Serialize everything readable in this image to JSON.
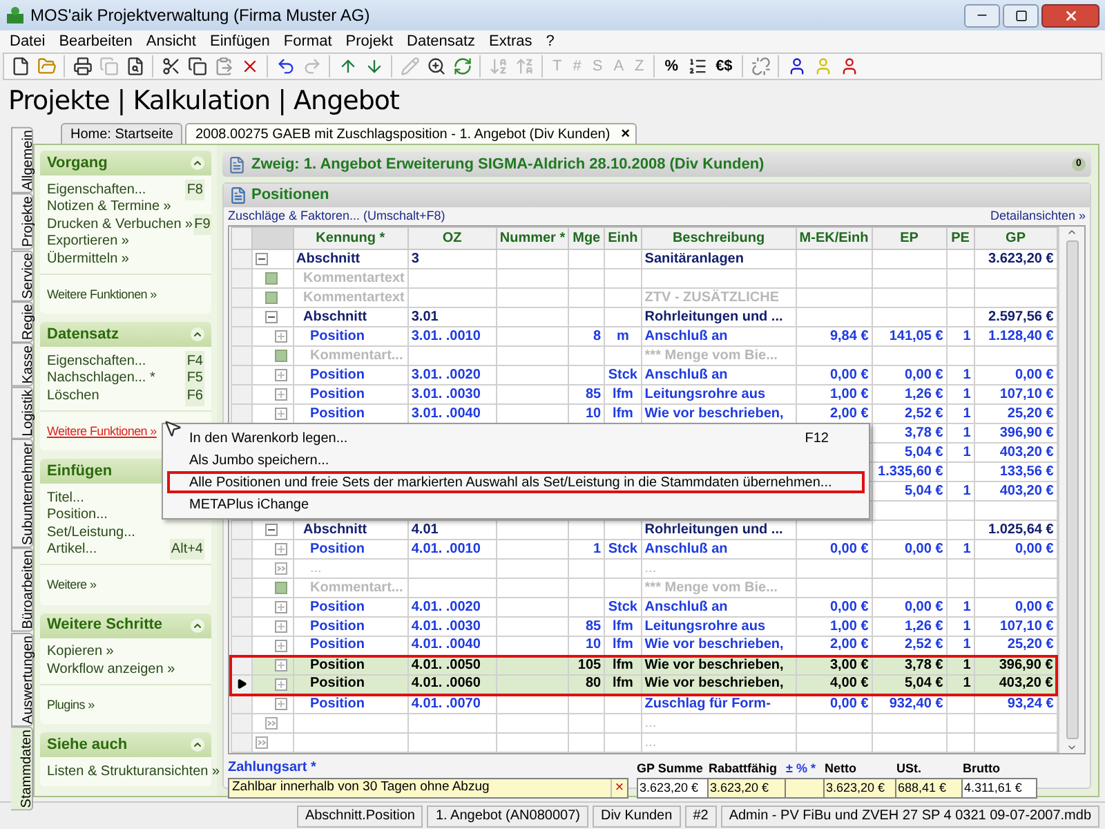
{
  "window": {
    "title": "MOS'aik Projektverwaltung (Firma Muster AG)"
  },
  "menu_bar": [
    "Datei",
    "Bearbeiten",
    "Ansicht",
    "Einfügen",
    "Format",
    "Projekt",
    "Datensatz",
    "Extras",
    "?"
  ],
  "toolbar": {
    "glyph_buttons": [
      {
        "label": "T",
        "disabled": true
      },
      {
        "label": "#",
        "disabled": true
      },
      {
        "label": "S",
        "disabled": true
      },
      {
        "label": "A",
        "disabled": true
      },
      {
        "label": "Z",
        "disabled": true
      },
      {
        "label": "%",
        "disabled": false
      },
      {
        "label": "€$",
        "disabled": false
      }
    ]
  },
  "breadcrumb": "Projekte | Kalkulation | Angebot",
  "side_tabs": [
    {
      "label": "Allgemein",
      "selected": false
    },
    {
      "label": "Projekte",
      "selected": false
    },
    {
      "label": "Service",
      "selected": false
    },
    {
      "label": "Regie",
      "selected": false
    },
    {
      "label": "Kasse",
      "selected": false
    },
    {
      "label": "Logistik",
      "selected": false
    },
    {
      "label": "Subunternehmer",
      "selected": false
    },
    {
      "label": "Büroarbeiten",
      "selected": false
    },
    {
      "label": "Auswertungen",
      "selected": false
    },
    {
      "label": "Stammdaten",
      "selected": true
    }
  ],
  "doc_tabs": [
    {
      "label": "Home: Startseite",
      "selected": false,
      "closable": false
    },
    {
      "label": "2008.00275 GAEB mit Zuschlagsposition - 1. Angebot (Div Kunden)",
      "selected": true,
      "closable": true
    }
  ],
  "close_glyph": "×",
  "sidebar": {
    "sections": [
      {
        "title": "Vorgang",
        "toggle": true,
        "items": [
          {
            "label": "Eigenschaften...",
            "shortcut": "F8"
          },
          {
            "label": "Notizen & Termine »"
          },
          {
            "label": "Drucken & Verbuchen »",
            "shortcut": "F9"
          },
          {
            "label": "Exportieren »"
          },
          {
            "label": "Übermitteln »"
          }
        ],
        "more": [
          {
            "label": "Weitere Funktionen »",
            "hovered": false
          }
        ]
      },
      {
        "title": "Datensatz",
        "toggle": true,
        "items": [
          {
            "label": "Eigenschaften...",
            "shortcut": "F4"
          },
          {
            "label": "Nachschlagen... *",
            "shortcut": "F5"
          },
          {
            "label": "Löschen",
            "shortcut": "F6"
          }
        ],
        "more": [
          {
            "label": "Weitere Funktionen »",
            "hovered": true
          }
        ]
      },
      {
        "title": "Einfügen",
        "toggle": false,
        "items": [
          {
            "label": "Titel..."
          },
          {
            "label": "Position..."
          },
          {
            "label": "Set/Leistung..."
          },
          {
            "label": "Artikel...",
            "shortcut": "Alt+4"
          }
        ],
        "more": [
          {
            "label": "Weitere »",
            "hovered": false
          }
        ]
      },
      {
        "title": "Weitere Schritte",
        "toggle": true,
        "items": [
          {
            "label": "Kopieren »"
          },
          {
            "label": "Workflow anzeigen »"
          }
        ],
        "more": [
          {
            "label": "Plugins »",
            "hovered": false
          }
        ]
      },
      {
        "title": "Siehe auch",
        "toggle": true,
        "items": [
          {
            "label": "Listen & Strukturansichten »"
          }
        ]
      }
    ]
  },
  "branch": {
    "title": "Zweig: 1. Angebot Erweiterung SIGMA-Aldrich 28.10.2008 (Div Kunden)",
    "badge": "0"
  },
  "positions": {
    "title": "Positionen",
    "left_link": "Zuschläge & Faktoren... (Umschalt+F8)",
    "right_link": "Detailansichten »",
    "table": {
      "columns": [
        "Kennung *",
        "OZ",
        "Nummer *",
        "Mge",
        "Einh",
        "Beschreibung",
        "M-EK/Einh",
        "EP",
        "PE",
        "GP"
      ],
      "rows": [
        {
          "kind": "abschnitt",
          "kennung": "Abschnitt",
          "oz": "3",
          "beschreibung": "Sanitäranlagen",
          "gp": "3.623,20 €",
          "selected": false,
          "current": false,
          "children": [
            {
              "kind": "kommentar",
              "kennung": "Kommentartext",
              "selected": false,
              "current": false
            },
            {
              "kind": "kommentar",
              "kennung": "Kommentartext",
              "beschreibung": "ZTV - ZUSÄTZLICHE",
              "selected": false,
              "current": false
            },
            {
              "kind": "abschnitt",
              "kennung": "Abschnitt",
              "oz": "3.01",
              "beschreibung": "Rohrleitungen und ...",
              "gp": "2.597,56 €",
              "selected": false,
              "current": false,
              "children": [
                {
                  "kind": "position",
                  "kennung": "Position",
                  "oz": "3.01.  .0010",
                  "mge": "8",
                  "einh": "m",
                  "beschreibung": "Anschluß an",
                  "m_ek": "9,84 €",
                  "ep": "141,05 €",
                  "pe": "1",
                  "gp": "1.128,40 €",
                  "selected": false,
                  "current": false
                },
                {
                  "kind": "kommentar",
                  "kennung": "Kommentart...",
                  "beschreibung": "*** Menge vom Bie...",
                  "selected": false,
                  "current": false
                },
                {
                  "kind": "position",
                  "kennung": "Position",
                  "oz": "3.01.  .0020",
                  "einh": "Stck",
                  "beschreibung": "Anschluß an",
                  "m_ek": "0,00 €",
                  "ep": "0,00 €",
                  "pe": "1",
                  "gp": "0,00 €",
                  "selected": false,
                  "current": false
                },
                {
                  "kind": "position",
                  "kennung": "Position",
                  "oz": "3.01.  .0030",
                  "mge": "85",
                  "einh": "lfm",
                  "beschreibung": "Leitungsrohre aus",
                  "m_ek": "1,00 €",
                  "ep": "1,26 €",
                  "pe": "1",
                  "gp": "107,10 €",
                  "selected": false,
                  "current": false
                },
                {
                  "kind": "position",
                  "kennung": "Position",
                  "oz": "3.01.  .0040",
                  "mge": "10",
                  "einh": "lfm",
                  "beschreibung": "Wie vor beschrieben,",
                  "m_ek": "2,00 €",
                  "ep": "2,52 €",
                  "pe": "1",
                  "gp": "25,20 €",
                  "selected": false,
                  "current": false
                },
                {
                  "kind": "covered",
                  "ep": "3,78 €",
                  "pe": "1",
                  "gp": "396,90 €",
                  "selected": false,
                  "current": false
                },
                {
                  "kind": "covered",
                  "ep": "5,04 €",
                  "pe": "1",
                  "gp": "403,20 €",
                  "selected": false,
                  "current": false
                },
                {
                  "kind": "covered",
                  "ep": "1.335,60 €",
                  "gp": "133,56 €",
                  "selected": false,
                  "current": false
                },
                {
                  "kind": "covered",
                  "ep": "5,04 €",
                  "pe": "1",
                  "gp": "403,20 €",
                  "selected": false,
                  "current": false
                },
                {
                  "kind": "covered",
                  "selected": false,
                  "current": false
                }
              ]
            },
            {
              "kind": "abschnitt",
              "kennung": "Abschnitt",
              "oz": "4.01",
              "beschreibung": "Rohrleitungen und ...",
              "gp": "1.025,64 €",
              "selected": false,
              "current": false,
              "children": [
                {
                  "kind": "position",
                  "kennung": "Position",
                  "oz": "4.01.  .0010",
                  "mge": "1",
                  "einh": "Stck",
                  "beschreibung": "Anschluß an",
                  "m_ek": "0,00 €",
                  "ep": "0,00 €",
                  "pe": "1",
                  "gp": "0,00 €",
                  "selected": false,
                  "current": false
                },
                {
                  "kind": "more",
                  "kennung": "...",
                  "beschreibung": "...",
                  "selected": false,
                  "current": false
                },
                {
                  "kind": "kommentar",
                  "kennung": "Kommentart...",
                  "beschreibung": "*** Menge vom Bie...",
                  "selected": false,
                  "current": false
                },
                {
                  "kind": "position",
                  "kennung": "Position",
                  "oz": "4.01.  .0020",
                  "einh": "Stck",
                  "beschreibung": "Anschluß an",
                  "m_ek": "0,00 €",
                  "ep": "0,00 €",
                  "pe": "1",
                  "gp": "0,00 €",
                  "selected": false,
                  "current": false
                },
                {
                  "kind": "position",
                  "kennung": "Position",
                  "oz": "4.01.  .0030",
                  "mge": "85",
                  "einh": "lfm",
                  "beschreibung": "Leitungsrohre aus",
                  "m_ek": "1,00 €",
                  "ep": "1,26 €",
                  "pe": "1",
                  "gp": "107,10 €",
                  "selected": false,
                  "current": false
                },
                {
                  "kind": "position",
                  "kennung": "Position",
                  "oz": "4.01.  .0040",
                  "mge": "10",
                  "einh": "lfm",
                  "beschreibung": "Wie vor beschrieben,",
                  "m_ek": "2,00 €",
                  "ep": "2,52 €",
                  "pe": "1",
                  "gp": "25,20 €",
                  "selected": false,
                  "current": false
                },
                {
                  "kind": "position",
                  "kennung": "Position",
                  "oz": "4.01.  .0050",
                  "mge": "105",
                  "einh": "lfm",
                  "beschreibung": "Wie vor beschrieben,",
                  "m_ek": "3,00 €",
                  "ep": "3,78 €",
                  "pe": "1",
                  "gp": "396,90 €",
                  "selected": true,
                  "current": false
                },
                {
                  "kind": "position",
                  "kennung": "Position",
                  "oz": "4.01.  .0060",
                  "mge": "80",
                  "einh": "lfm",
                  "beschreibung": "Wie vor beschrieben,",
                  "m_ek": "4,00 €",
                  "ep": "5,04 €",
                  "pe": "1",
                  "gp": "403,20 €",
                  "selected": true,
                  "current": true
                },
                {
                  "kind": "position",
                  "kennung": "Position",
                  "oz": "4.01.  .0070",
                  "beschreibung": "Zuschlag für Form-",
                  "m_ek": "0,00 €",
                  "ep": "932,40 €",
                  "gp": "93,24 €",
                  "selected": false,
                  "current": false
                }
              ]
            },
            {
              "kind": "more",
              "beschreibung": "...",
              "selected": false,
              "current": false
            }
          ]
        },
        {
          "kind": "more",
          "beschreibung": "...",
          "selected": false,
          "current": false
        }
      ]
    }
  },
  "payment": {
    "label": "Zahlungsart *",
    "value": "Zahlbar innerhalb von 30 Tagen ohne Abzug",
    "clear_glyph": "×"
  },
  "totals": [
    {
      "label": "GP Summe",
      "value": "3.623,20 €",
      "editable": false
    },
    {
      "label": "Rabattfähig",
      "value": "3.623,20 €",
      "editable": true
    },
    {
      "label": "± % *",
      "editable": true
    },
    {
      "label": "Netto",
      "value": "3.623,20 €",
      "editable": true
    },
    {
      "label": "USt.",
      "value": "688,41 €",
      "editable": true
    },
    {
      "label": "Brutto",
      "value": "4.311,61 €",
      "editable": false
    }
  ],
  "context_menu": [
    {
      "label": "In den Warenkorb legen...",
      "shortcut": "F12",
      "highlighted": false
    },
    {
      "label": "Als Jumbo speichern...",
      "highlighted": false
    },
    {
      "label": "Alle Positionen und freie Sets der markierten Auswahl als Set/Leistung in die Stammdaten übernehmen...",
      "highlighted": true
    },
    {
      "label": "METAPlus iChange",
      "highlighted": false
    }
  ],
  "status_bar": [
    "Abschnitt.Position",
    "1. Angebot (AN080007)",
    "Div Kunden",
    "#2",
    "Admin - PV FiBu und ZVEH 27 SP 4 0321 09-07-2007.mdb"
  ]
}
